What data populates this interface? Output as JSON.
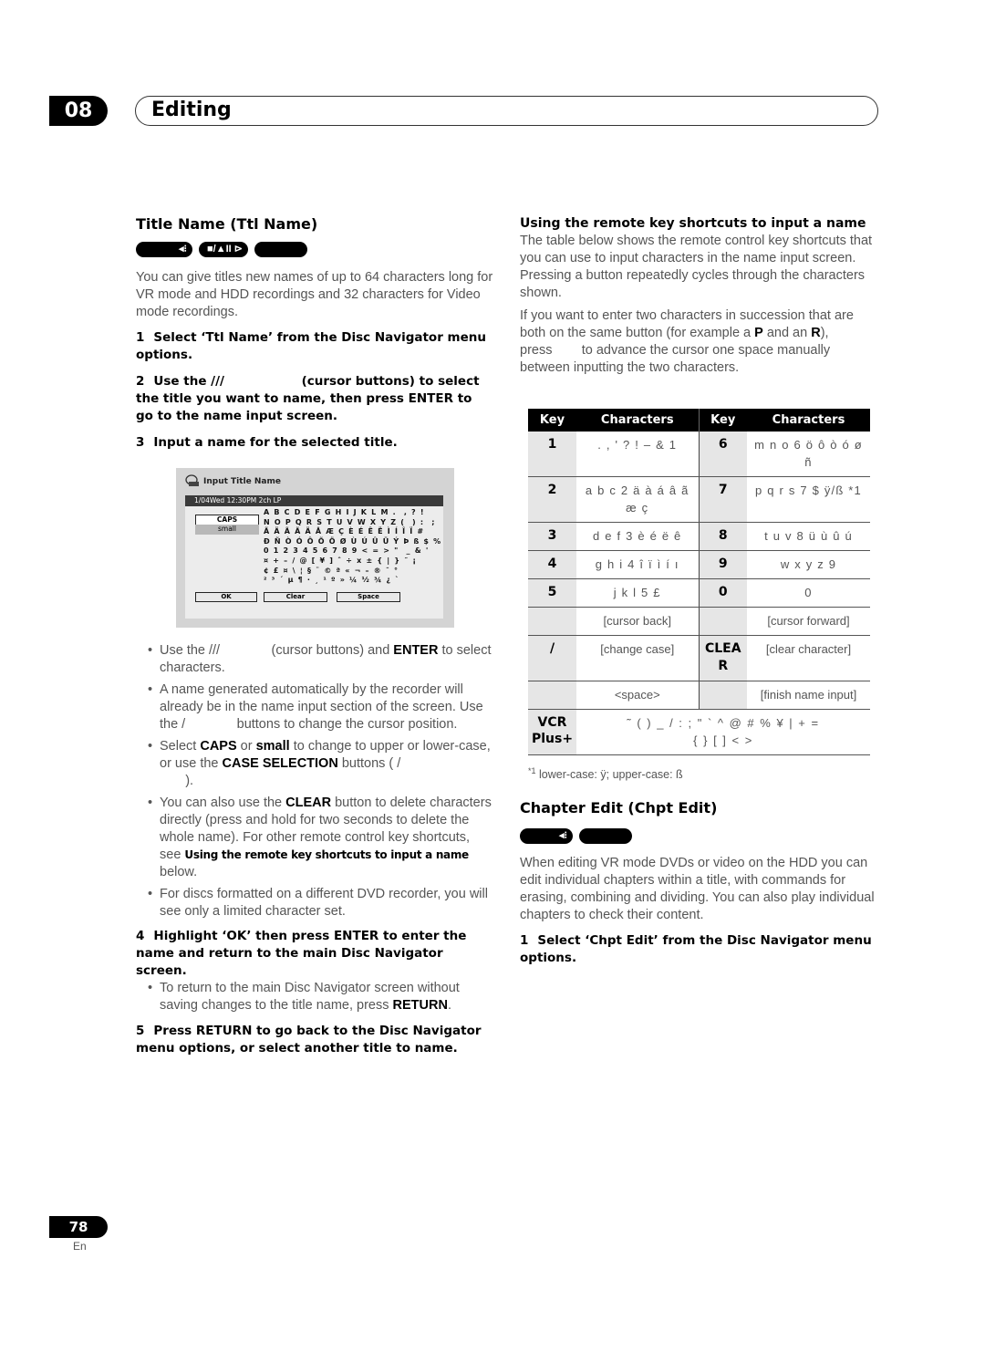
{
  "header": {
    "chapter_number": "08",
    "chapter_title": "Editing"
  },
  "title_name_section": {
    "heading": "Title Name (Ttl Name)",
    "intro": "You can give titles new names of up to 64 characters long for VR mode and HDD recordings and 32 characters for Video mode recordings.",
    "steps": [
      {
        "num": "1",
        "text": "Select ‘Ttl Name’ from the Disc Navigator menu options."
      },
      {
        "num": "2",
        "pre": "Use the ///",
        "post": "(cursor buttons) to select the title you want to name, then press ENTER to go to the name input screen."
      },
      {
        "num": "3",
        "text": "Input a name for the selected title."
      },
      {
        "num": "4",
        "text": "Highlight ‘OK’ then press ENTER to enter the name and return to the main Disc Navigator screen."
      },
      {
        "num": "5",
        "text": "Press RETURN to go back to the Disc Navigator menu options, or select another title to name."
      }
    ],
    "bullets_step3": [
      {
        "a": "Use the ///",
        "b": "(cursor buttons) and ",
        "bold": "ENTER",
        "c": " to select characters."
      },
      {
        "a": "A name generated automatically by the recorder will already be in the name input section of the screen. Use the /",
        "b": "buttons to change the cursor position."
      },
      {
        "a": "Select ",
        "bold1": "CAPS",
        "b": " or ",
        "bold2": "small",
        "c": " to change to upper or lower-case, or use the ",
        "bold3": "CASE SELECTION",
        "d": " buttons ( /",
        "e": ")."
      },
      {
        "a": "You can also use the ",
        "bold": "CLEAR",
        "b": " button to delete characters directly (press and hold for two seconds to delete the whole name). For other remote control key shortcuts, see ",
        "xref": "Using the remote key shortcuts to input a name",
        "c": " below."
      },
      {
        "a": "For discs formatted on a different DVD recorder, you will see only a limited character set."
      }
    ],
    "bullet_step4": {
      "a": "To return to the main Disc Navigator screen without saving changes to the title name, press ",
      "bold": "RETURN",
      "b": "."
    }
  },
  "screen": {
    "title": "Input Title Name",
    "status_bar": "1/04Wed 12:30PM   2ch LP",
    "caps_label": "CAPS",
    "small_label": "small",
    "char_grid": "A B C D E F G H I J K L M .  , ? !\nN O P Q R S T U V W X Y Z (  ) :  ;\nÃ Ä Ã Ã Ä Å Æ Ç È É Ê Ë Ì Í Î Ï #\nÐ Ñ Ò Ó Ô Õ Ö Ø Ù Ú Û Ü Ý Þ ß $ %\n0 1 2 3 4 5 6 7 8 9 < = > \"  _ & '\n¤ + – / @ [ ¥ ] ˆ ÷ x ± { | } ˜ ¡\n¢ £ ¤ \\ ¦ § ¨ © ª « ¬ – ® ¯ °\n² ³ ´ µ ¶ · ¸ ¹ º » ¼ ½ ¾ ¿ `",
    "ok_label": "OK",
    "clear_label": "Clear",
    "space_label": "Space"
  },
  "shortcuts_section": {
    "heading": "Using the remote key shortcuts to input a name",
    "para1": "The table below shows the remote control key shortcuts that you can use to input characters in the name input screen. Pressing a button repeatedly cycles through the characters shown.",
    "para2_a": "If you want to enter two characters in succession that are both on the same button (for example a ",
    "para2_p": "P",
    "para2_b": " and an ",
    "para2_r": "R",
    "para2_c": "), press",
    "para2_d": "to advance the cursor one space manually between inputting the two characters.",
    "table": {
      "headers": [
        "Key",
        "Characters",
        "Key",
        "Characters"
      ],
      "rows": [
        [
          "1",
          ". , ' ? ! – & 1",
          "6",
          "m n o 6 ö ô ò ó ø ñ"
        ],
        [
          "2",
          "a b c 2 ä à á â ã æ ç",
          "7",
          "p q r s 7 $ ÿ/ß *1"
        ],
        [
          "3",
          "d e f 3 è é ë ê",
          "8",
          "t u v 8 ü ù û ú"
        ],
        [
          "4",
          "g h i 4 î ï ì í ı",
          "9",
          "w x y z 9"
        ],
        [
          "5",
          "j k l 5 £",
          "0",
          "0"
        ],
        [
          "",
          "[cursor back]",
          "",
          "[cursor forward]"
        ],
        [
          "/",
          "[change case]",
          "CLEAR",
          "[clear character]"
        ],
        [
          "",
          "<space>",
          "",
          "[finish name input]"
        ]
      ],
      "vcr_key": "VCR Plus+",
      "vcr_chars_line1": "˜ ( ) _ / : ; \" ` ^ @ #   % ¥ | + =",
      "vcr_chars_line2": "{ } [ ] < >"
    },
    "footnote_mark": "*1",
    "footnote": "lower-case: ÿ; upper-case: ß"
  },
  "chapter_edit_section": {
    "heading": "Chapter Edit (Chpt Edit)",
    "intro": "When editing VR mode DVDs or video on the HDD you can edit individual chapters within a title, with commands for erasing, combining and dividing. You can also play individual chapters to check their content.",
    "step1_num": "1",
    "step1": "Select ‘Chpt Edit’ from the Disc Navigator menu options."
  },
  "footer": {
    "page_number": "78",
    "language": "En"
  }
}
